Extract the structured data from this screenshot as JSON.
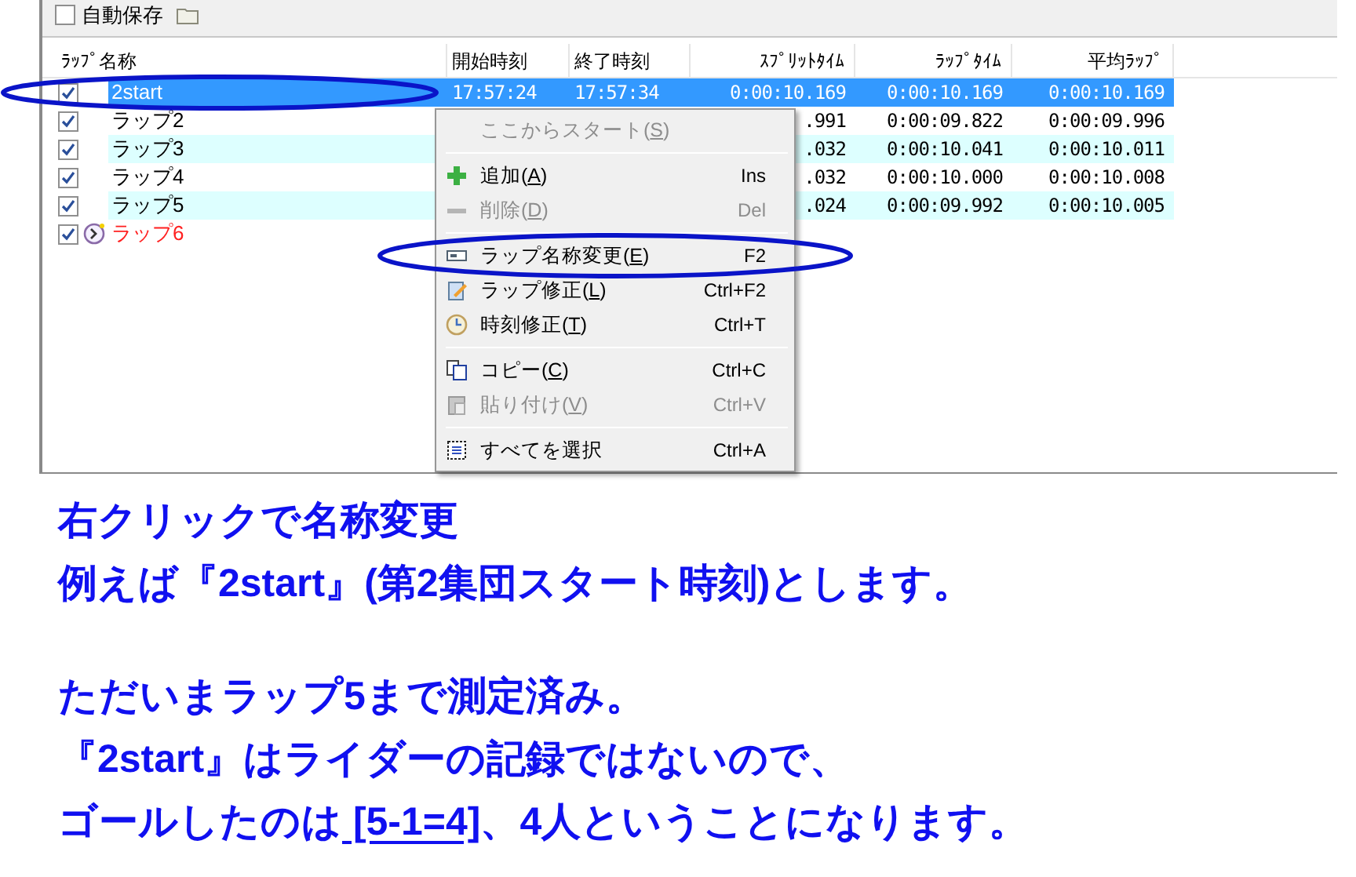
{
  "toolbar": {
    "autosave": {
      "label": "自動保存",
      "checked": false
    }
  },
  "table": {
    "columns": [
      "ﾗｯﾌﾟ名称",
      "開始時刻",
      "終了時刻",
      "ｽﾌﾟﾘｯﾄﾀｲﾑ",
      "ﾗｯﾌﾟﾀｲﾑ",
      "平均ﾗｯﾌﾟ"
    ],
    "rows": [
      {
        "checked": true,
        "selected": true,
        "running": false,
        "name": "2start",
        "start": "17:57:24",
        "end": "17:57:34",
        "split": "0:00:10.169",
        "lap": "0:00:10.169",
        "average": "0:00:10.169"
      },
      {
        "checked": true,
        "selected": false,
        "running": false,
        "name": "ラップ2",
        "split": ".991",
        "lap": "0:00:09.822",
        "average": "0:00:09.996"
      },
      {
        "checked": true,
        "selected": false,
        "running": false,
        "name": "ラップ3",
        "split": ".032",
        "lap": "0:00:10.041",
        "average": "0:00:10.011"
      },
      {
        "checked": true,
        "selected": false,
        "running": false,
        "name": "ラップ4",
        "split": ".032",
        "lap": "0:00:10.000",
        "average": "0:00:10.008"
      },
      {
        "checked": true,
        "selected": false,
        "running": false,
        "name": "ラップ5",
        "split": ".024",
        "lap": "0:00:09.992",
        "average": "0:00:10.005"
      },
      {
        "checked": true,
        "selected": false,
        "running": true,
        "name": "ラップ6"
      }
    ]
  },
  "context_menu": [
    {
      "kind": "item",
      "label": "ここからスタート(S)",
      "disabled": true
    },
    {
      "kind": "separator"
    },
    {
      "kind": "item",
      "label": "追加(A)",
      "shortcut": "Ins",
      "disabled": false
    },
    {
      "kind": "item",
      "label": "削除(D)",
      "shortcut": "Del",
      "disabled": true
    },
    {
      "kind": "separator"
    },
    {
      "kind": "item",
      "label": "ラップ名称変更(E)",
      "shortcut": "F2",
      "disabled": false
    },
    {
      "kind": "item",
      "label": "ラップ修正(L)",
      "shortcut": "Ctrl+F2",
      "disabled": false
    },
    {
      "kind": "item",
      "label": "時刻修正(T)",
      "shortcut": "Ctrl+T",
      "disabled": false
    },
    {
      "kind": "separator"
    },
    {
      "kind": "item",
      "label": "コピー(C)",
      "shortcut": "Ctrl+C",
      "disabled": false
    },
    {
      "kind": "item",
      "label": "貼り付け(V)",
      "shortcut": "Ctrl+V",
      "disabled": true
    },
    {
      "kind": "separator"
    },
    {
      "kind": "item",
      "label": "すべてを選択",
      "shortcut": "Ctrl+A",
      "disabled": false
    }
  ],
  "notes": [
    [
      [
        {
          "text": "右クリックで名称変更",
          "underline": false
        }
      ],
      [
        {
          "text": "例えば『2start』(第2集団スタート時刻)とします。",
          "underline": false
        }
      ]
    ],
    [
      [
        {
          "text": "ただいまラップ5まで測定済み。",
          "underline": false
        }
      ],
      [
        {
          "text": "『2start』はライダーの記録ではないので、",
          "underline": false
        }
      ],
      [
        {
          "text": "ゴールしたのは",
          "underline": false
        },
        {
          "text": " [5-1=4]",
          "underline": true
        },
        {
          "text": "、4人ということになります。",
          "underline": false
        }
      ]
    ]
  ]
}
